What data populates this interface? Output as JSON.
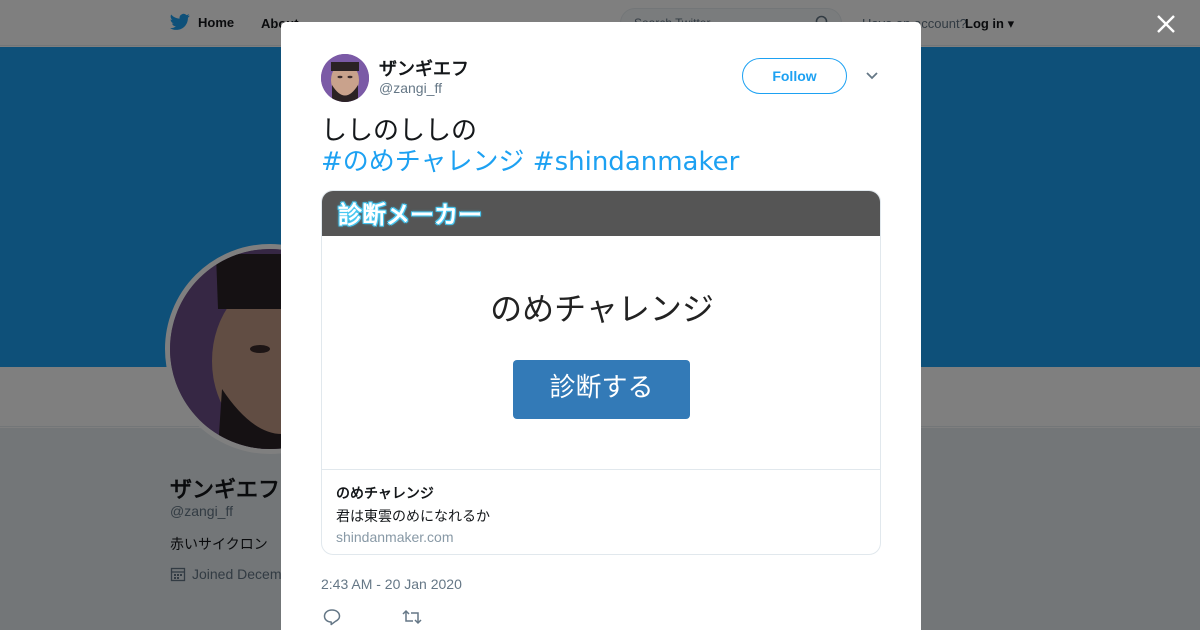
{
  "nav": {
    "home_label": "Home",
    "about_label": "About",
    "search_placeholder": "Search Twitter",
    "account_prompt": "Have an account?",
    "login_label": "Log in"
  },
  "profile": {
    "name": "ザンギエフ",
    "handle": "@zangi_ff",
    "bio": "赤いサイクロン",
    "joined": "Joined December"
  },
  "tweet": {
    "author_name": "ザンギエフ",
    "author_handle": "@zangi_ff",
    "follow_label": "Follow",
    "text_line": "ししのししの",
    "hashtag_1": "#のめチャレンジ",
    "hashtag_2": "#shindanmaker",
    "timestamp": "2:43 AM - 20 Jan 2020"
  },
  "card": {
    "header_logo": "診断メーカー",
    "image_title": "のめチャレンジ",
    "image_button": "診断する",
    "title": "のめチャレンジ",
    "description": "君は東雲のめになれるか",
    "domain": "shindanmaker.com"
  },
  "colors": {
    "accent": "#1da1f2",
    "banner": "#1da1f2",
    "card_button": "#337ab7",
    "card_header": "#555555"
  },
  "icons": {
    "close": "close-icon",
    "reply": "reply-icon",
    "retweet": "retweet-icon",
    "more": "chevron-down-icon",
    "bird": "twitter-bird-icon"
  }
}
